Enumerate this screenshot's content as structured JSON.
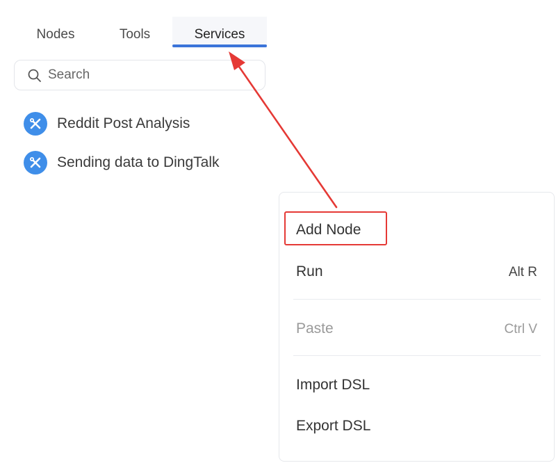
{
  "tabs": [
    {
      "label": "Nodes"
    },
    {
      "label": "Tools"
    },
    {
      "label": "Services",
      "active": true
    }
  ],
  "search": {
    "placeholder": "Search",
    "value": ""
  },
  "services": [
    {
      "label": "Reddit Post Analysis",
      "icon": "tools-icon"
    },
    {
      "label": "Sending data to DingTalk",
      "icon": "tools-icon"
    }
  ],
  "context_menu": {
    "items": [
      {
        "label": "Add Node",
        "shortcut": "",
        "disabled": false,
        "highlighted": true
      },
      {
        "label": "Run",
        "shortcut": "Alt R",
        "disabled": false
      },
      {
        "label": "Paste",
        "shortcut": "Ctrl V",
        "disabled": true
      },
      {
        "label": "Import DSL",
        "shortcut": "",
        "disabled": false
      },
      {
        "label": "Export DSL",
        "shortcut": "",
        "disabled": false
      }
    ]
  },
  "colors": {
    "accent": "#3b74d9",
    "service_icon_bg": "#3f8ee9",
    "annotation_red": "#e53935",
    "disabled_text": "#9a9a9a"
  }
}
